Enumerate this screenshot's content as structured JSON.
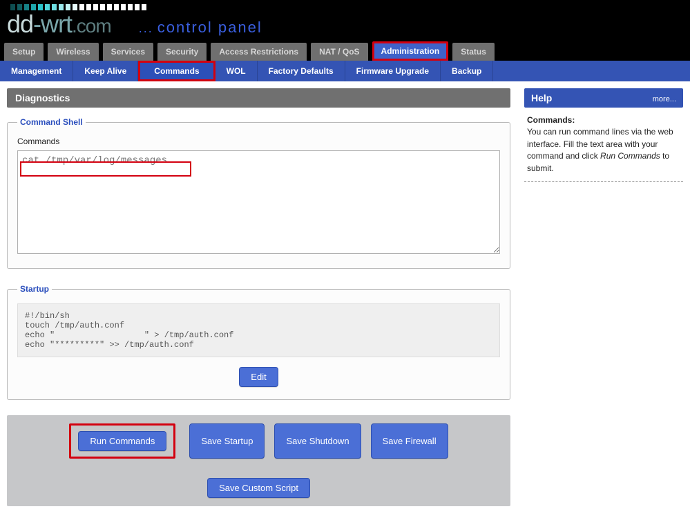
{
  "logo": {
    "dd": "dd",
    "wrt": "-wrt",
    "com": ".com",
    "control": "control panel",
    "dots": "..."
  },
  "topnav": [
    "Setup",
    "Wireless",
    "Services",
    "Security",
    "Access Restrictions",
    "NAT / QoS",
    "Administration",
    "Status"
  ],
  "topnav_active_index": 6,
  "subnav": [
    "Management",
    "Keep Alive",
    "Commands",
    "WOL",
    "Factory Defaults",
    "Firmware Upgrade",
    "Backup"
  ],
  "subnav_active_index": 2,
  "section_title": "Diagnostics",
  "command_shell": {
    "legend": "Command Shell",
    "label": "Commands",
    "value": "cat /tmp/var/log/messages"
  },
  "startup": {
    "legend": "Startup",
    "script": "#!/bin/sh\ntouch /tmp/auth.conf\necho \"                  \" > /tmp/auth.conf\necho \"*********\" >> /tmp/auth.conf",
    "edit_label": "Edit"
  },
  "actions": {
    "run": "Run Commands",
    "save_startup": "Save Startup",
    "save_shutdown": "Save Shutdown",
    "save_firewall": "Save Firewall",
    "save_custom": "Save Custom Script"
  },
  "help": {
    "title": "Help",
    "more": "more...",
    "heading": "Commands:",
    "body_pre": "You can run command lines via the web interface. Fill the text area with your command and click ",
    "body_em": "Run Commands",
    "body_post": " to submit."
  }
}
